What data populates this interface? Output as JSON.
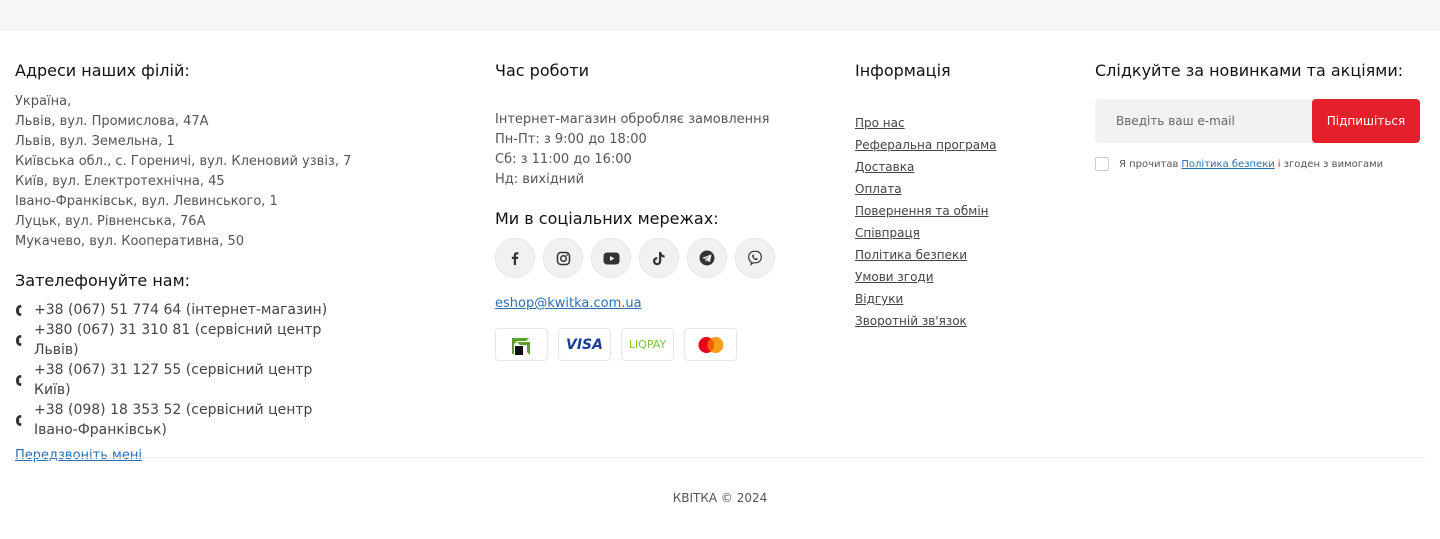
{
  "branches": {
    "title": "Адреси наших філій:",
    "addresses": [
      "Україна,",
      "Львів, вул. Промислова, 47А",
      "Львів, вул. Земельна, 1",
      "Київська обл., с. Гореничі, вул. Кленовий узвіз, 7",
      "Київ, вул. Електротехнічна, 45",
      "Івано-Франківськ, вул. Левинського, 1",
      "Луцьк, вул. Рівненська, 76А",
      "Мукачево, вул. Кооперативна, 50"
    ]
  },
  "phones": {
    "title": "Зателефонуйте нам:",
    "items": [
      "+38 (067) 51 774 64 (інтернет-магазин)",
      "+380 (067) 31 310 81 (сервісний центр Львів)",
      "+38 (067) 31 127 55 (сервісний центр Київ)",
      "+38 (098) 18 353 52 (сервісний центр Івано-Франківськ)"
    ],
    "callback_label": "Передзвоніть мені"
  },
  "hours": {
    "title": "Час роботи",
    "lines": [
      "Інтернет-магазин обробляє замовлення",
      "Пн-Пт: з 9:00 до 18:00",
      "Сб: з 11:00 до 16:00",
      "Нд: вихідний"
    ]
  },
  "social": {
    "title": "Ми в соціальних мережах:",
    "icons": [
      "facebook-icon",
      "instagram-icon",
      "youtube-icon",
      "tiktok-icon",
      "telegram-icon",
      "viber-icon"
    ],
    "email": "eshop@kwitka.com.ua",
    "payments": {
      "visa": "VISA",
      "liqpay": "LIQPAY"
    }
  },
  "info": {
    "title": "Інформація",
    "links": [
      "Про нас",
      "Реферальна програма",
      "Доставка",
      "Оплата",
      "Повернення та обмін",
      "Співпраця",
      "Політика безпеки",
      "Умови згоди",
      "Відгуки",
      "Зворотній зв'язок"
    ]
  },
  "subscribe": {
    "title": "Слідкуйте за новинками та акціями:",
    "placeholder": "Введіть ваш e-mail",
    "button_label": "Підпишіться",
    "agree_prefix": "Я прочитав",
    "agree_link": "Політика безпеки",
    "agree_suffix": "і згоден з вимогами"
  },
  "footer": {
    "copyright": "КВІТКА © 2024"
  },
  "colors": {
    "accent_red": "#e4202a",
    "link_blue": "#2a6fb0"
  }
}
